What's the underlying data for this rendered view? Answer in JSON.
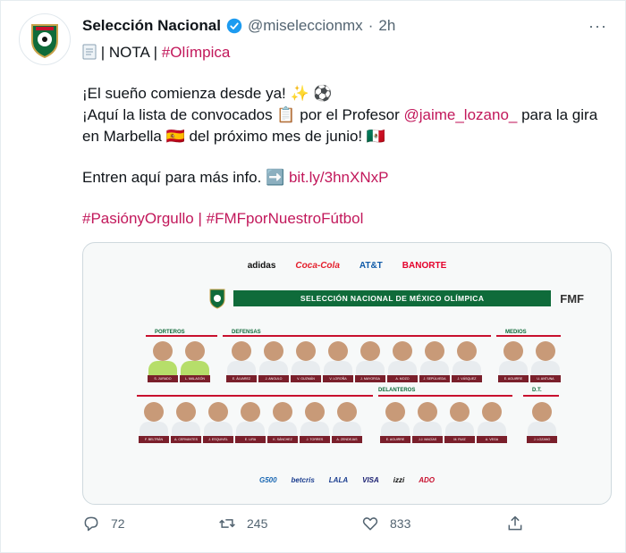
{
  "user": {
    "name": "Selección Nacional",
    "handle": "@miseleccionmx",
    "separator": "·",
    "time": "2h",
    "more_label": "···"
  },
  "tweet": {
    "line1_prefix": "| NOTA |",
    "line1_hashtag": "#Olímpica",
    "line2": "¡El sueño comienza desde ya! ✨ ⚽",
    "line3_a": "¡Aquí la lista de convocados 📋 por el Profesor",
    "line3_mention": "@jaime_lozano_",
    "line3_b": "para la gira",
    "line4": "en Marbella 🇪🇸 del próximo mes de junio! 🇲🇽",
    "line5_text": "Entren aquí para más info. ➡️",
    "line5_link": "bit.ly/3hnXNxP",
    "hashtag1": "#PasiónyOrgullo",
    "hashtag_sep": "|",
    "hashtag2": "#FMFporNuestroFútbol"
  },
  "media": {
    "sponsors_top": [
      "adidas",
      "Coca-Cola",
      "AT&T",
      "BANORTE"
    ],
    "banner_title": "SELECCIÓN NACIONAL DE MÉXICO OLÍMPICA",
    "fmf": "FMF",
    "groups": {
      "porteros": "PORTEROS",
      "defensas": "DEFENSAS",
      "medios": "MEDIOS",
      "delanteros": "DELANTEROS",
      "dt": "D.T."
    },
    "porteros": [
      "S. JURADO",
      "L. MALAGÓN"
    ],
    "defensas": [
      "E. ÁLVAREZ",
      "J. ANGULO",
      "V. GUZMÁN",
      "V. LOROÑA",
      "J. MAYORGA",
      "A. MOZO",
      "J. SEPÚLVEDA",
      "J. VÁSQUEZ"
    ],
    "medios_top": [
      "E. AGUIRRE",
      "U. ANTUNA"
    ],
    "medios_bottom": [
      "F. BELTRÁN",
      "A. CERVANTES",
      "J. ESQUIVEL",
      "E. LIRA",
      "K. SÁNCHEZ",
      "J. TORRES",
      "A. ZENDEJAS"
    ],
    "delanteros": [
      "E. AGUIRRE",
      "J.J. MACÍAS",
      "M. RUIZ",
      "A. VEGA"
    ],
    "dt": [
      "J. LOZANO"
    ],
    "sponsors_bottom": [
      "G500",
      "betcris",
      "LALA",
      "VISA",
      "izzi",
      "ADO"
    ]
  },
  "actions": {
    "replies": "72",
    "retweets": "245",
    "likes": "833"
  }
}
